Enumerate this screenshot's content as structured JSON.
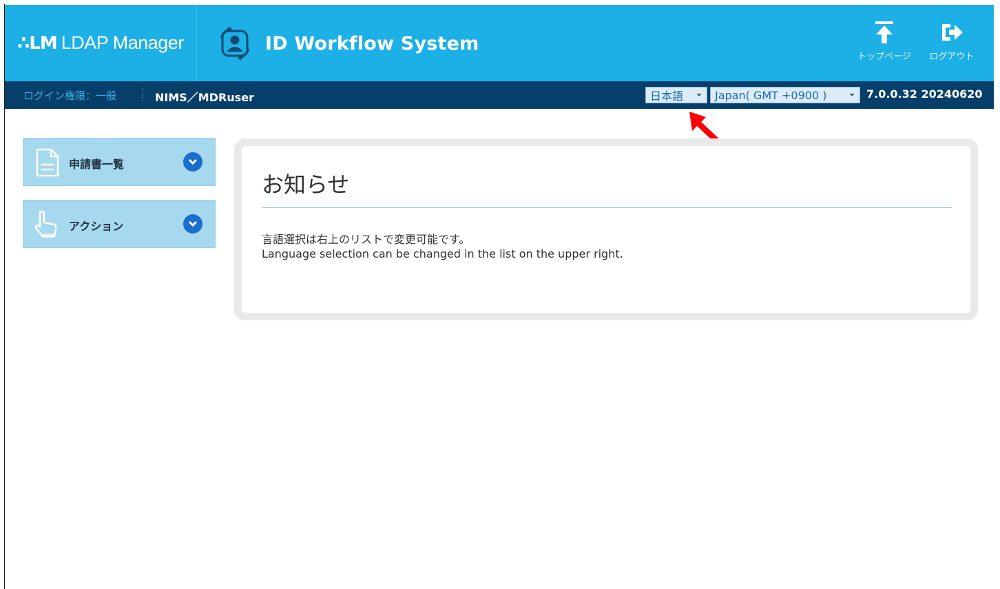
{
  "header": {
    "brand_mark": "∴LM",
    "brand_name": "LDAP Manager",
    "system_title": "ID Workflow System",
    "top_page_label": "トップページ",
    "logout_label": "ログアウト"
  },
  "subbar": {
    "permission": "ログイン権限：一般",
    "user": "NIMS／MDRuser",
    "language": "日本語",
    "timezone": "Japan( GMT +0900 )",
    "version": "7.0.0.32 20240620"
  },
  "sidebar": {
    "items": [
      {
        "label": "申請書一覧",
        "icon": "document-icon"
      },
      {
        "label": "アクション",
        "icon": "pointer-hand-icon"
      }
    ]
  },
  "notice": {
    "title": "お知らせ",
    "line1": "言語選択は右上のリストで変更可能です。",
    "line2": "Language selection can be changed in the list on the upper right."
  },
  "colors": {
    "header_bg": "#1cb0e6",
    "subbar_bg": "#073f6b",
    "menu_bg": "#a6d8ee",
    "chevron_bg": "#1a6fce",
    "arrow": "#ff0000"
  }
}
